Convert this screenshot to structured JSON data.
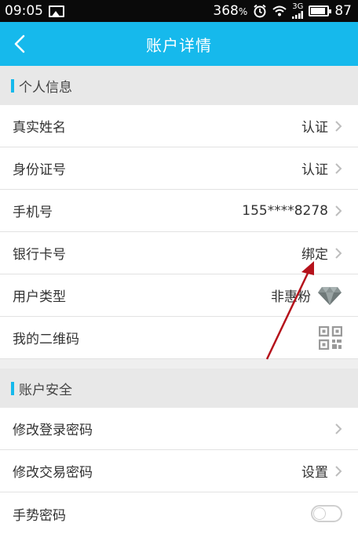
{
  "status_bar": {
    "time": "09:05",
    "network": "368",
    "network_unit": "%",
    "signal_label": "3G",
    "battery": "87",
    "icons": [
      "image-icon",
      "alarm-icon",
      "wifi-icon",
      "signal-icon",
      "battery-icon"
    ]
  },
  "header": {
    "title": "账户详情",
    "back_icon": "chevron-left-icon",
    "background": "#16b9ec"
  },
  "sections": {
    "personal": {
      "title": "个人信息",
      "rows": [
        {
          "label": "真实姓名",
          "value": "认证"
        },
        {
          "label": "身份证号",
          "value": "认证"
        },
        {
          "label": "手机号",
          "value": "155****8278"
        },
        {
          "label": "银行卡号",
          "value": "绑定"
        },
        {
          "label": "用户类型",
          "value": "非惠粉"
        },
        {
          "label": "我的二维码"
        }
      ]
    },
    "security": {
      "title": "账户安全",
      "rows": [
        {
          "label": "修改登录密码",
          "value": ""
        },
        {
          "label": "修改交易密码",
          "value": "设置"
        },
        {
          "label": "手势密码",
          "toggle": false
        }
      ]
    }
  },
  "colors": {
    "accent": "#16b9ec",
    "annotation_arrow": "#b5121b"
  }
}
